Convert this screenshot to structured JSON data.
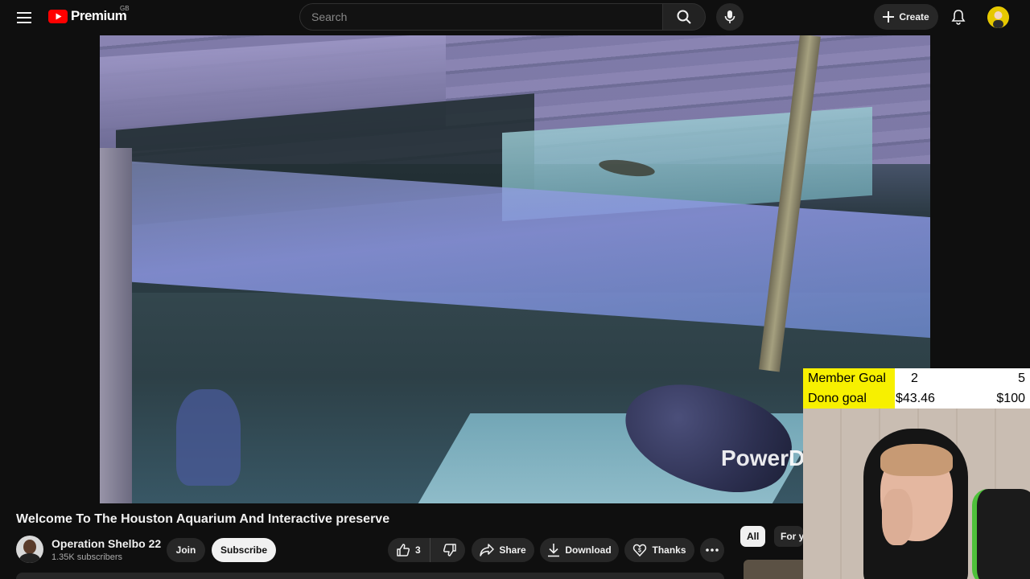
{
  "header": {
    "logo_text": "Premium",
    "country_code": "GB",
    "search_placeholder": "Search",
    "create_label": "Create"
  },
  "video": {
    "watermark": "PowerD"
  },
  "overlay": {
    "member_goal_label": "Member Goal",
    "member_goal_current": "2",
    "member_goal_target": "5",
    "dono_goal_label": "Dono goal",
    "dono_goal_current": "$43.46",
    "dono_goal_target": "$100"
  },
  "meta": {
    "title": "Welcome To The Houston Aquarium And Interactive preserve",
    "channel_name": "Operation Shelbo 22",
    "subscribers": "1.35K subscribers",
    "join_label": "Join",
    "subscribe_label": "Subscribe",
    "like_count": "3",
    "share_label": "Share",
    "download_label": "Download",
    "thanks_label": "Thanks"
  },
  "chips": {
    "all": "All",
    "for_you": "For yo"
  },
  "colors": {
    "background": "#0f0f0f",
    "brand_red": "#ff0000",
    "goal_highlight": "#f7f000",
    "pill_bg": "#272727"
  }
}
